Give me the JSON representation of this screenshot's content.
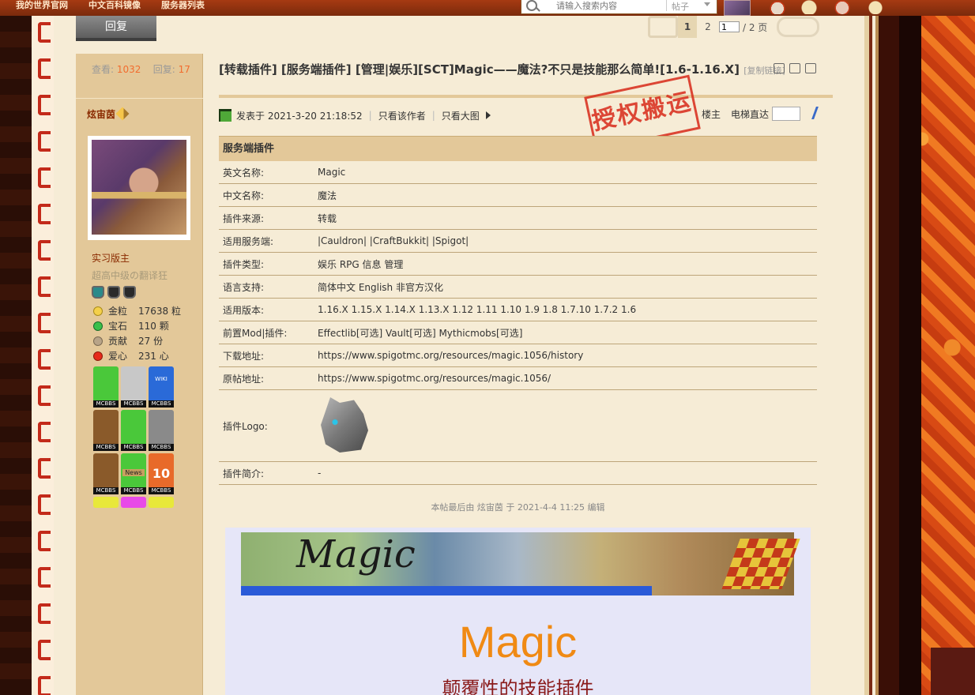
{
  "topnav": {
    "links": [
      "我的世界官网",
      "中文百科镜像",
      "服务器列表"
    ],
    "search_placeholder": "请输入搜索内容",
    "search_type": "帖子"
  },
  "toolbar": {
    "reply_label": "回复",
    "pager": {
      "current": "1",
      "next_page": "2",
      "input_value": "1",
      "total": "/ 2 页"
    }
  },
  "sidebar": {
    "views_label": "查看:",
    "views": "1032",
    "replies_label": "回复:",
    "replies": "17",
    "author": "炫宙茵",
    "rank": "实习版主",
    "custom_title": "超高中级の翻译狂",
    "credits": [
      {
        "label": "金粒",
        "value": "17638 粒",
        "icon": "gold-nugget-icon"
      },
      {
        "label": "宝石",
        "value": "110 颗",
        "icon": "emerald-icon"
      },
      {
        "label": "贡献",
        "value": "27 份",
        "icon": "contribution-icon"
      },
      {
        "label": "爱心",
        "value": "231 心",
        "icon": "heart-icon"
      }
    ],
    "medal_tag": "MCBBS",
    "medal_wiki": "WIKI",
    "medal_news": "News",
    "medal_ten": "10"
  },
  "thread": {
    "title": "[转载插件] [服务端插件] [管理|娱乐][SCT]Magic——魔法?不只是技能那么简单![1.6-1.16.X]",
    "copy_link": "[复制链接]",
    "post_time": "发表于 2021-3-20 21:18:52",
    "only_author": "只看该作者",
    "only_large_img": "只看大图",
    "stamp_text": "授权搬运",
    "floor": "楼主",
    "elevator": "电梯直达"
  },
  "info_table": {
    "header": "服务端插件",
    "rows": [
      {
        "k": "英文名称:",
        "v": "Magic"
      },
      {
        "k": "中文名称:",
        "v": "魔法"
      },
      {
        "k": "插件来源:",
        "v": "转载"
      },
      {
        "k": "适用服务端:",
        "v": "|Cauldron| |CraftBukkit| |Spigot|"
      },
      {
        "k": "插件类型:",
        "v": "娱乐 RPG 信息 管理"
      },
      {
        "k": "语言支持:",
        "v": "简体中文 English 非官方汉化"
      },
      {
        "k": "适用版本:",
        "v": "1.16.X 1.15.X 1.14.X 1.13.X 1.12 1.11 1.10 1.9 1.8 1.7.10 1.7.2 1.6"
      },
      {
        "k": "前置Mod|插件:",
        "v": "Effectlib[可选] Vault[可选] Mythicmobs[可选]"
      },
      {
        "k": "下载地址:",
        "v": "https://www.spigotmc.org/resources/magic.1056/history"
      },
      {
        "k": "原帖地址:",
        "v": "https://www.spigotmc.org/resources/magic.1056/"
      }
    ],
    "logo_label": "插件Logo:",
    "intro_label": "插件简介:",
    "intro_value": "-"
  },
  "edit_note": "本帖最后由 炫宙茵 于 2021-4-4 11:25 编辑",
  "content": {
    "banner_text": "Magic",
    "big_title": "Magic",
    "subtitle": "颠覆性的技能插件"
  }
}
